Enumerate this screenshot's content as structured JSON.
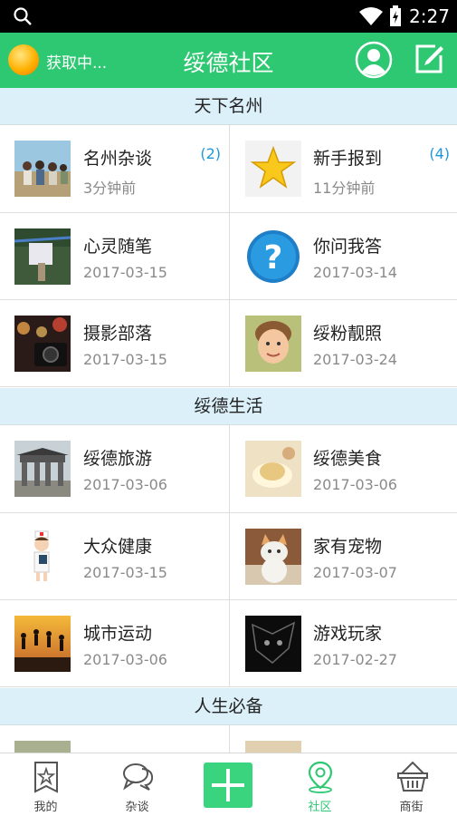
{
  "status_bar": {
    "time": "2:27"
  },
  "header": {
    "location": "获取中...",
    "title": "绥德社区"
  },
  "sections": [
    {
      "title": "天下名州",
      "items": [
        {
          "title": "名州杂谈",
          "sub": "3分钟前",
          "badge": "(2)",
          "icon": "people-photo"
        },
        {
          "title": "新手报到",
          "sub": "11分钟前",
          "badge": "(4)",
          "icon": "star-icon"
        },
        {
          "title": "心灵随笔",
          "sub": "2017-03-15",
          "icon": "clothesline-photo"
        },
        {
          "title": "你问我答",
          "sub": "2017-03-14",
          "icon": "question-icon"
        },
        {
          "title": "摄影部落",
          "sub": "2017-03-15",
          "icon": "camera-photo"
        },
        {
          "title": "绥粉靓照",
          "sub": "2017-03-24",
          "icon": "child-photo"
        }
      ]
    },
    {
      "title": "绥德生活",
      "items": [
        {
          "title": "绥德旅游",
          "sub": "2017-03-06",
          "icon": "archway-photo"
        },
        {
          "title": "绥德美食",
          "sub": "2017-03-06",
          "icon": "food-photo"
        },
        {
          "title": "大众健康",
          "sub": "2017-03-15",
          "icon": "nurse-icon"
        },
        {
          "title": "家有宠物",
          "sub": "2017-03-07",
          "icon": "cat-photo"
        },
        {
          "title": "城市运动",
          "sub": "2017-03-06",
          "icon": "jumping-photo"
        },
        {
          "title": "游戏玩家",
          "sub": "2017-02-27",
          "icon": "game-photo"
        }
      ]
    },
    {
      "title": "人生必备",
      "items": [
        {
          "title": "",
          "sub": "",
          "icon": "partial-photo"
        },
        {
          "title": "",
          "sub": "",
          "icon": "partial-photo"
        }
      ]
    }
  ],
  "bottom_nav": [
    {
      "label": "我的",
      "icon": "profile-star-icon",
      "active": false
    },
    {
      "label": "杂谈",
      "icon": "chat-icon",
      "active": false
    },
    {
      "label": "",
      "icon": "plus-icon",
      "active": false
    },
    {
      "label": "社区",
      "icon": "location-pin-icon",
      "active": true
    },
    {
      "label": "商街",
      "icon": "basket-icon",
      "active": false
    }
  ],
  "colors": {
    "accent": "#2ec872",
    "section_bg": "#dcf0fa",
    "badge": "#1e96d8"
  }
}
